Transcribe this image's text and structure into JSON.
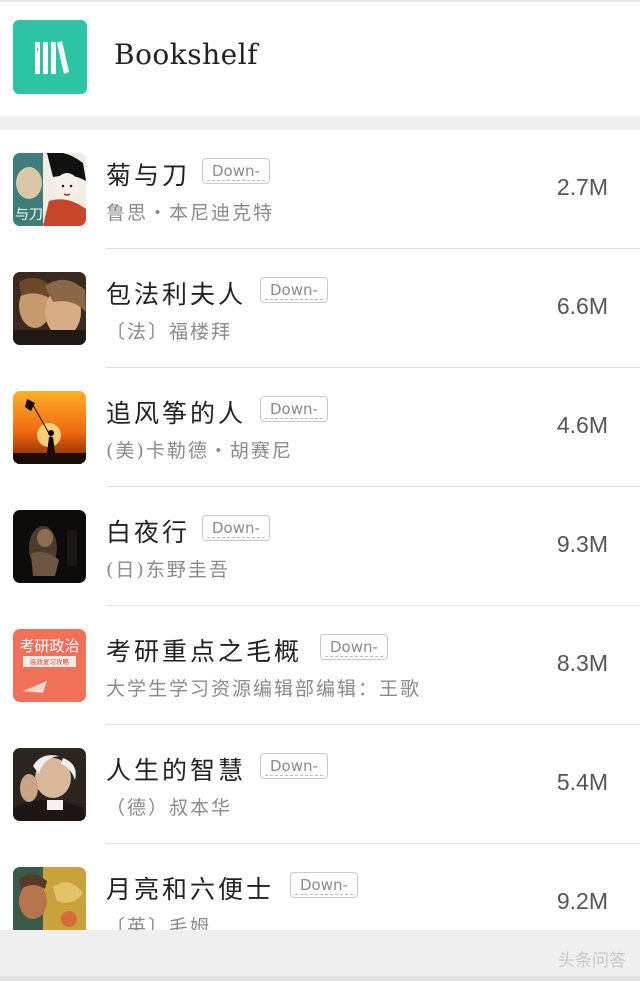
{
  "header": {
    "title": "Bookshelf",
    "icon": "bookshelf-icon",
    "accent": "#2dc4a6"
  },
  "download_label": "Down-",
  "books": [
    {
      "title": "菊与刀",
      "author": "鲁思・本尼迪克特",
      "size": "2.7M",
      "cover_text": "与刀"
    },
    {
      "title": "包法利夫人",
      "author": "〔法〕福楼拜",
      "size": "6.6M"
    },
    {
      "title": "追风筝的人",
      "author": "(美)卡勒德・胡赛尼",
      "size": "4.6M"
    },
    {
      "title": "白夜行",
      "author": "(日)东野圭吾",
      "size": "9.3M"
    },
    {
      "title": "考研重点之毛概",
      "author": "大学生学习资源编辑部编辑：王歌",
      "size": "8.3M",
      "cover_text": "考研政治",
      "cover_subtext": "高效复习攻略"
    },
    {
      "title": "人生的智慧",
      "author": "（德）叔本华",
      "size": "5.4M"
    },
    {
      "title": "月亮和六便士",
      "author": "〔英〕毛姆",
      "size": "9.2M"
    }
  ],
  "watermark": "头条问答"
}
